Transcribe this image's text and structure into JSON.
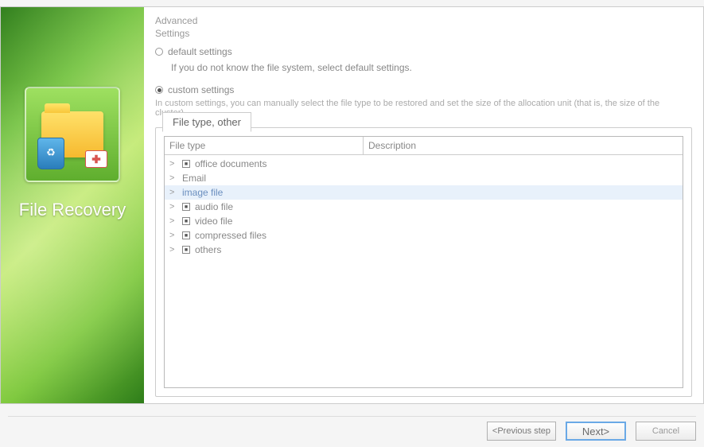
{
  "sidebar": {
    "title": "File Recovery"
  },
  "advanced": {
    "heading_line1": "Advanced",
    "heading_line2": "Settings",
    "default": {
      "label": "default settings",
      "hint": "If you do not know the file system, select default settings."
    },
    "custom": {
      "label": "custom settings",
      "hint": "In custom settings, you can manually select the file type to be restored and set the size of the allocation unit (that is, the size of the cluster)."
    }
  },
  "tab": {
    "label": "File type, other"
  },
  "tree": {
    "head": {
      "filetype": "File type",
      "description": "Description"
    },
    "items": [
      {
        "label": "office documents",
        "checkbox": true
      },
      {
        "label": "Email",
        "checkbox": false
      },
      {
        "label": "image file",
        "checkbox": false,
        "selected": true
      },
      {
        "label": "audio file",
        "checkbox": true
      },
      {
        "label": "video file",
        "checkbox": true
      },
      {
        "label": "compressed files",
        "checkbox": true
      },
      {
        "label": "others",
        "checkbox": true
      }
    ]
  },
  "buttons": {
    "prev": "<Previous step",
    "next": "Next>",
    "cancel": "Cancel"
  }
}
